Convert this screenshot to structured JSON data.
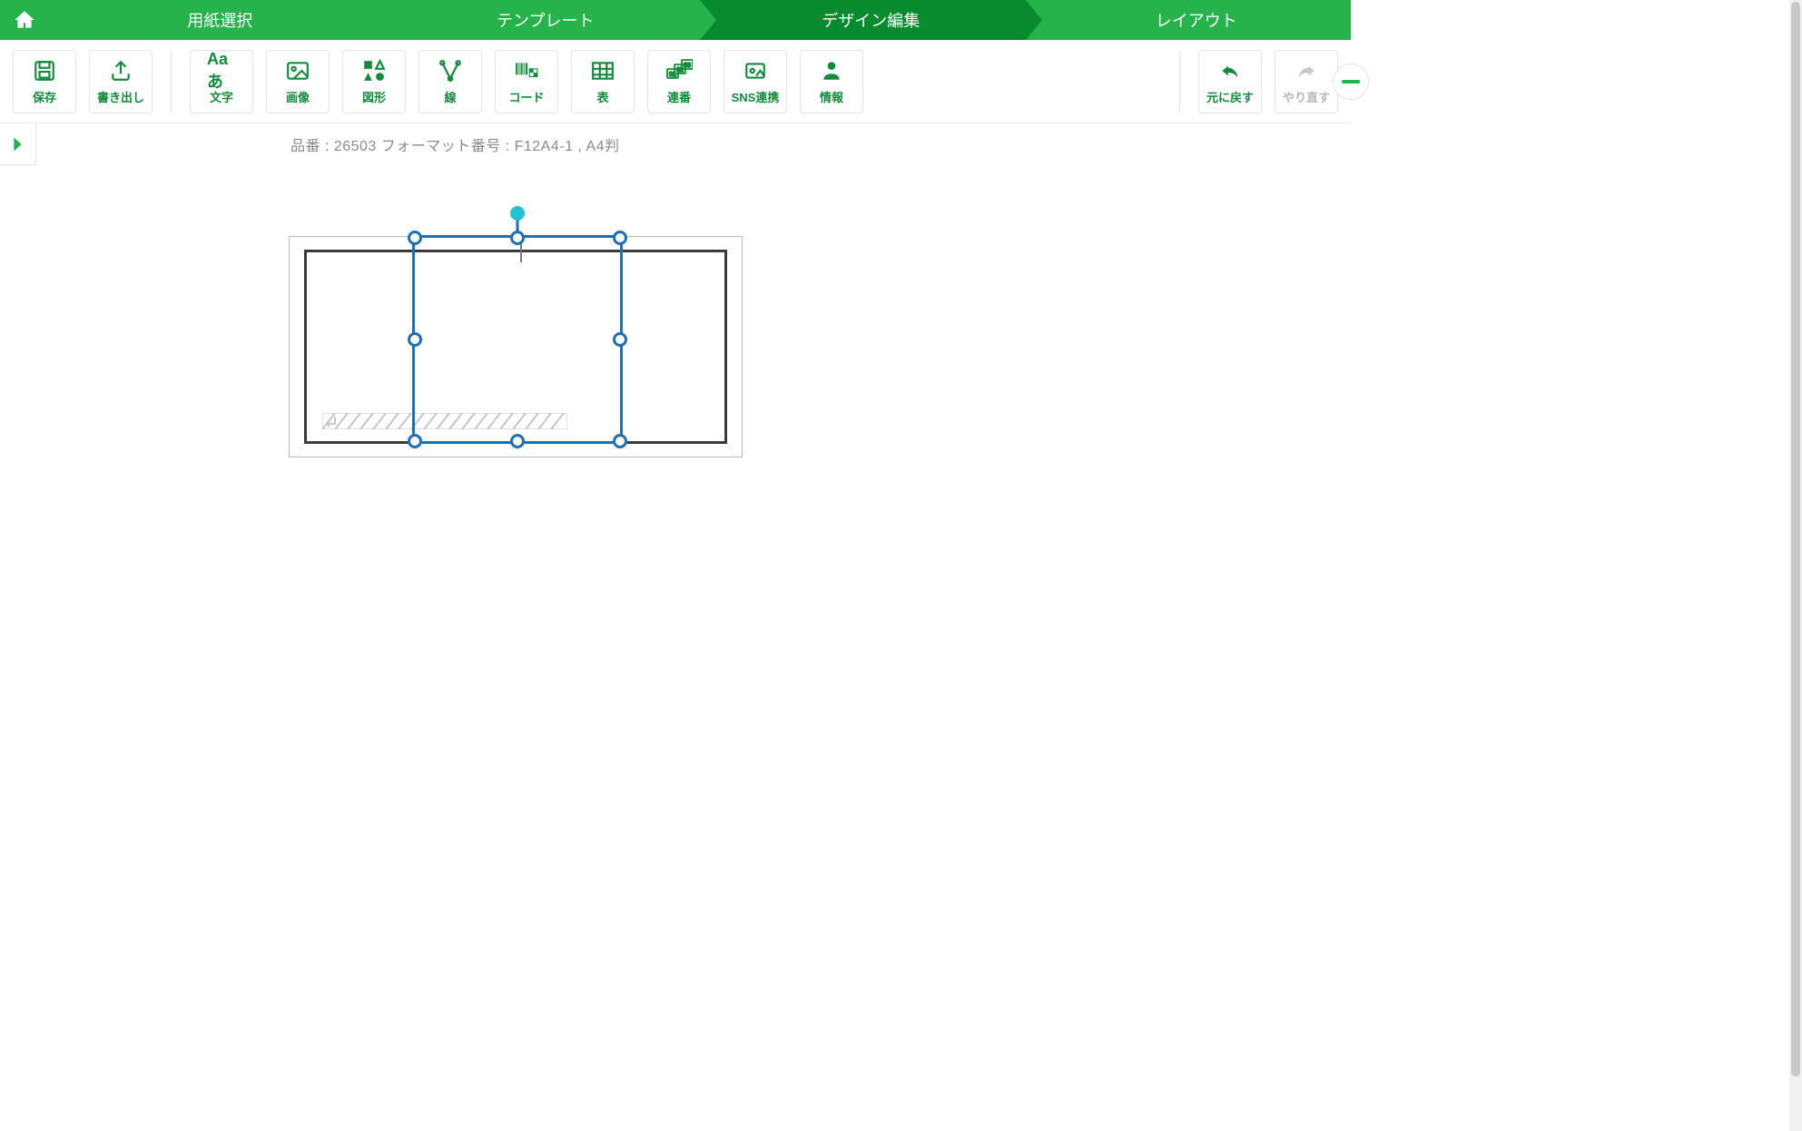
{
  "wizard": {
    "home": "home",
    "steps": [
      {
        "label": "用紙選択",
        "active": false
      },
      {
        "label": "テンプレート",
        "active": false
      },
      {
        "label": "デザイン編集",
        "active": true
      },
      {
        "label": "レイアウト",
        "active": false
      }
    ]
  },
  "toolbar": {
    "save": "保存",
    "export": "書き出し",
    "text": "文字",
    "image": "画像",
    "shape": "図形",
    "line": "線",
    "code": "コード",
    "table": "表",
    "serial": "連番",
    "sns": "SNS連携",
    "info": "情報",
    "undo": "元に戻す",
    "redo": "やり直す"
  },
  "paper_info": "品番 : 26503 フォーマット番号 : F12A4-1 , A4判"
}
